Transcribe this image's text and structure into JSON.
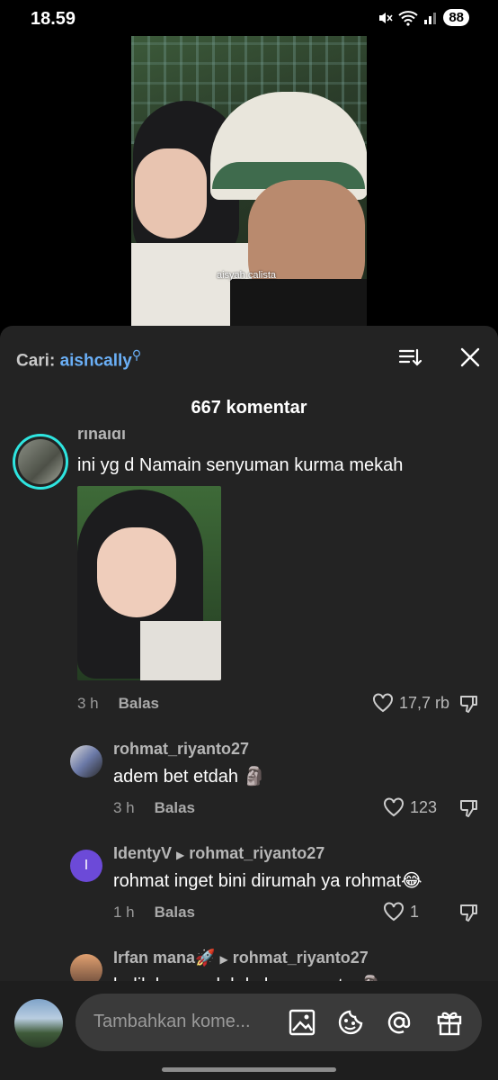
{
  "status": {
    "time": "18.59",
    "battery": "88"
  },
  "video": {
    "caption": "aisyah calista"
  },
  "header": {
    "search_label": "Cari:",
    "search_term": "aishcally",
    "comment_count": "667 komentar"
  },
  "comments": [
    {
      "user": "rinaldi",
      "text": "ini yg d Namain senyuman kurma mekah",
      "time": "3 h",
      "reply": "Balas",
      "likes": "17,7 rb"
    },
    {
      "user": "rohmat_riyanto27",
      "text": "adem bet etdah 🗿",
      "time": "3 h",
      "reply": "Balas",
      "likes": "123"
    },
    {
      "user": "IdentyV",
      "reply_to": "rohmat_riyanto27",
      "avatar_letter": "I",
      "text": "rohmat inget bini dirumah ya rohmat😂",
      "time": "1 h",
      "reply": "Balas",
      "likes": "1"
    },
    {
      "user": "Irfan mana🚀",
      "reply_to": "rohmat_riyanto27",
      "text": "balik bang udah kelamaan ntar🗿"
    }
  ],
  "input": {
    "placeholder": "Tambahkan kome..."
  },
  "colors": {
    "accent": "#6aaff6",
    "sheet": "#232323",
    "ring": "#2ee5e0"
  }
}
